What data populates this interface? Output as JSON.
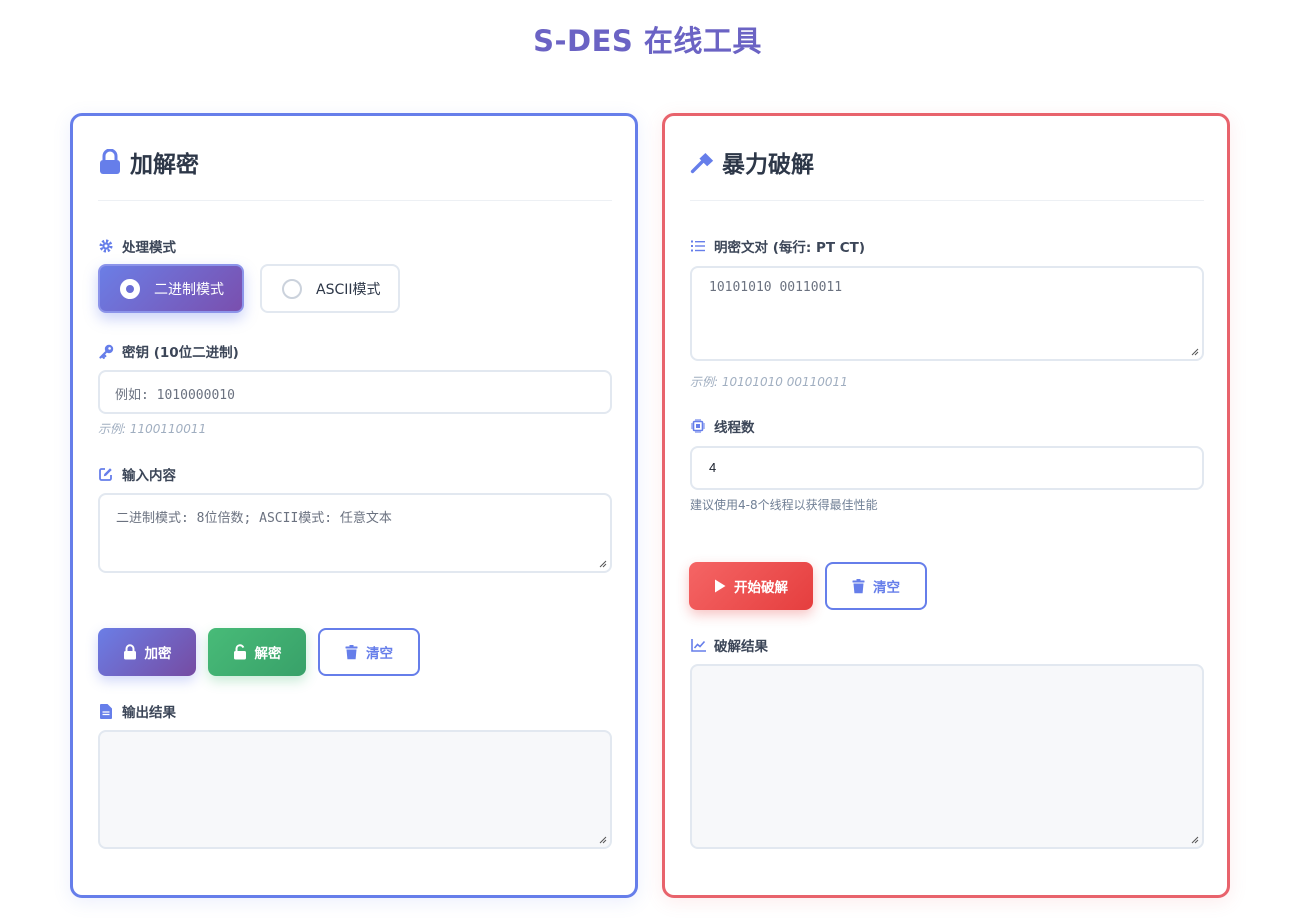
{
  "page": {
    "title": "S-DES 在线工具"
  },
  "colors": {
    "accent": "#667eea",
    "danger": "#e8636c",
    "success": "#48bb78",
    "title": "#6b63c4"
  },
  "crypto": {
    "title": "加解密",
    "title_icon": "lock-icon",
    "mode": {
      "label": "处理模式",
      "icon": "gear-icon",
      "options": [
        {
          "label": "二进制模式",
          "selected": true
        },
        {
          "label": "ASCII模式",
          "selected": false
        }
      ]
    },
    "key": {
      "label": "密钥 (10位二进制)",
      "icon": "key-icon",
      "placeholder": "例如: 1010000010",
      "value": "",
      "hint": "示例: 1100110011"
    },
    "input": {
      "label": "输入内容",
      "icon": "edit-icon",
      "placeholder": "二进制模式: 8位倍数; ASCII模式: 任意文本",
      "value": ""
    },
    "buttons": {
      "encrypt": "加密",
      "decrypt": "解密",
      "clear": "清空"
    },
    "output": {
      "label": "输出结果",
      "icon": "file-icon",
      "value": ""
    }
  },
  "brute": {
    "title": "暴力破解",
    "title_icon": "hammer-icon",
    "pairs": {
      "label": "明密文对 (每行: PT CT)",
      "icon": "list-icon",
      "placeholder": "10101010 00110011",
      "value": "",
      "hint": "示例: 10101010 00110011"
    },
    "threads": {
      "label": "线程数",
      "icon": "cpu-icon",
      "value": "4",
      "hint": "建议使用4-8个线程以获得最佳性能"
    },
    "buttons": {
      "start": "开始破解",
      "clear": "清空"
    },
    "result": {
      "label": "破解结果",
      "icon": "chart-line-icon",
      "value": ""
    }
  }
}
